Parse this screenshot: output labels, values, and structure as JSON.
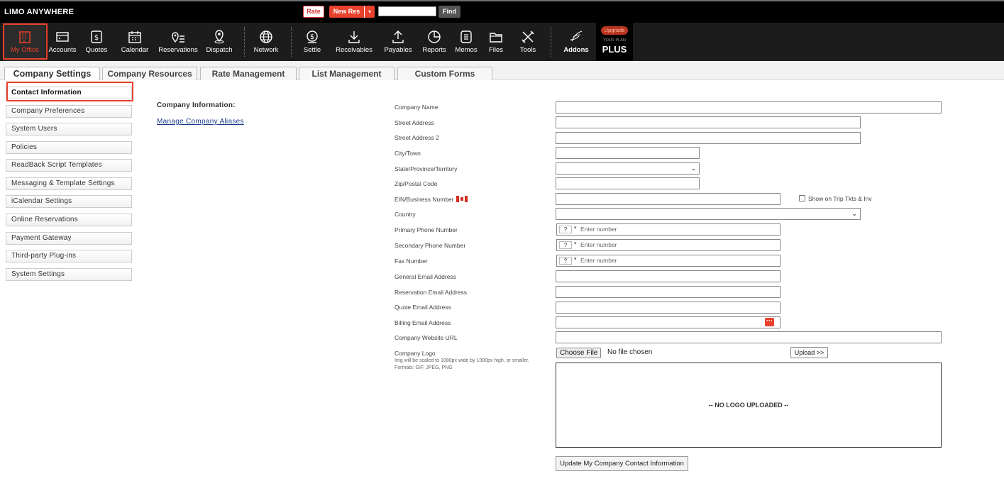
{
  "app": {
    "logo": "LIMO ANYWHERE"
  },
  "topbar": {
    "rate_label": "Rate",
    "newres_label": "New Res",
    "newres_caret": "▾",
    "search_value": "",
    "find_label": "Find"
  },
  "nav": {
    "items": [
      {
        "label": "My Office",
        "icon": "office-building-icon"
      },
      {
        "label": "Accounts",
        "icon": "accounts-icon"
      },
      {
        "label": "Quotes",
        "icon": "quotes-icon"
      },
      {
        "label": "Calendar",
        "icon": "calendar-icon"
      },
      {
        "label": "Reservations",
        "icon": "reservations-icon"
      },
      {
        "label": "Dispatch",
        "icon": "dispatch-pin-icon"
      },
      {
        "label": "Network",
        "icon": "globe-icon"
      },
      {
        "label": "Settle",
        "icon": "settle-icon"
      },
      {
        "label": "Receivables",
        "icon": "download-icon"
      },
      {
        "label": "Payables",
        "icon": "upload-icon"
      },
      {
        "label": "Reports",
        "icon": "pie-chart-icon"
      },
      {
        "label": "Memos",
        "icon": "memo-icon"
      },
      {
        "label": "Files",
        "icon": "folder-icon"
      },
      {
        "label": "Tools",
        "icon": "tools-icon"
      },
      {
        "label": "Addons",
        "icon": "addons-icon"
      }
    ],
    "upgrade_label": "Upgrade",
    "plan_caption": "YOUR PLAN",
    "plan_name": "PLUS"
  },
  "tabs": [
    {
      "label": "Company Settings",
      "active": true
    },
    {
      "label": "Company Resources"
    },
    {
      "label": "Rate Management"
    },
    {
      "label": "List Management"
    },
    {
      "label": "Custom Forms"
    }
  ],
  "sidebar": {
    "items": [
      {
        "label": "Contact Information",
        "active": true
      },
      {
        "label": "Company Preferences"
      },
      {
        "label": "System Users"
      },
      {
        "label": "Policies"
      },
      {
        "label": "ReadBack Script Templates"
      },
      {
        "label": "Messaging & Template Settings"
      },
      {
        "label": "iCalendar Settings"
      },
      {
        "label": "Online Reservations"
      },
      {
        "label": "Payment Gateway"
      },
      {
        "label": "Third-party Plug-ins"
      },
      {
        "label": "System Settings"
      }
    ]
  },
  "main": {
    "section_title": "Company Information:",
    "alias_link": "Manage Company Aliases",
    "fields": {
      "company_name": {
        "label": "Company Name",
        "value": ""
      },
      "street1": {
        "label": "Street Address",
        "value": ""
      },
      "street2": {
        "label": "Street Address 2",
        "value": ""
      },
      "city": {
        "label": "City/Town",
        "value": ""
      },
      "state": {
        "label": "State/Province/Territory",
        "value": ""
      },
      "zip": {
        "label": "Zip/Postal Code",
        "value": ""
      },
      "ein": {
        "label": "EIN/Business Number",
        "value": ""
      },
      "show_on_trip": {
        "label": "Show on Trip Tkts & Inv",
        "checked": false
      },
      "country": {
        "label": "Country",
        "value": ""
      },
      "primary_phone": {
        "label": "Primary Phone Number",
        "country_code": "?",
        "placeholder": "Enter number"
      },
      "secondary_phone": {
        "label": "Secondary Phone Number",
        "country_code": "?",
        "placeholder": "Enter number"
      },
      "fax": {
        "label": "Fax Number",
        "country_code": "?",
        "placeholder": "Enter number"
      },
      "general_email": {
        "label": "General Email Address",
        "value": ""
      },
      "reservation_email": {
        "label": "Reservation Email Address",
        "value": ""
      },
      "quote_email": {
        "label": "Quote Email Address",
        "value": ""
      },
      "billing_email": {
        "label": "Billing Email Address",
        "value": ""
      },
      "website": {
        "label": "Company Website URL",
        "value": ""
      }
    },
    "logo": {
      "label": "Company Logo",
      "hint1": "Img will be scaled to 1080px wide by 1080px high, or smaller.",
      "hint2": "Formats: GIF, JPEG, PNG",
      "choose_label": "Choose File",
      "file_status": "No file chosen",
      "upload_label": "Upload >>",
      "placeholder": "-- NO LOGO UPLOADED --"
    },
    "update_button": "Update My Company Contact Information"
  },
  "colors": {
    "accent": "#e8412c",
    "topbar": "#000000",
    "navbar": "#1c1c1c",
    "link": "#1b3c8c"
  }
}
